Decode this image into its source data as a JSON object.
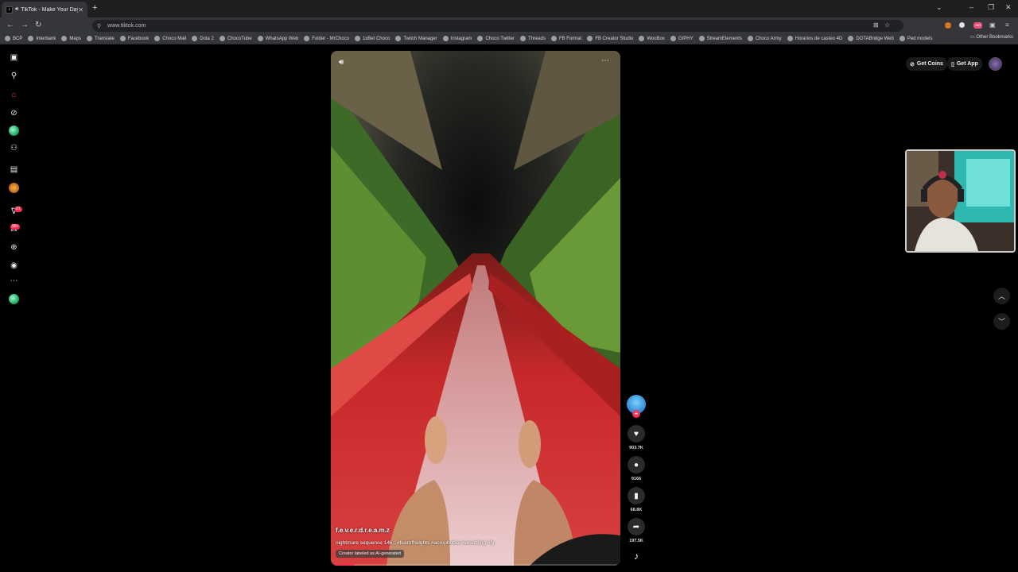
{
  "browser": {
    "tab_title": "TikTok - Make Your Day",
    "url": "www.tiktok.com",
    "bookmarks": [
      "BCP",
      "Interbank",
      "Maps",
      "Translate",
      "Facebook",
      "Choco Mail",
      "Dota 2",
      "ChocoTube",
      "WhatsApp Web",
      "Folder - MrChoco",
      "1xBet Choco",
      "Twitch Manager",
      "Instagram",
      "Choco Twitter",
      "Threads",
      "FB Format",
      "FB Creator Studio",
      "WooBox",
      "GIPHY",
      "StreamElements",
      "Choco Army",
      "Horarios de casteo 4D",
      "DOTABridge Web",
      "Ped models"
    ],
    "other_bookmarks": "Other Bookmarks",
    "ext_badge": "JAR"
  },
  "sidebar": {
    "badges": {
      "notifications": "21",
      "messages": "99+"
    }
  },
  "header": {
    "get_coins": "Get Coins",
    "get_app": "Get App"
  },
  "video": {
    "username": "f.e.v.e.r.d.r.e.a.m.z",
    "caption": "nightmare sequence 146...#fearofheights #acrophobia #unsettling #fy",
    "ai_label": "Creator labeled as AI-generated",
    "progress": 0.08
  },
  "actions": {
    "likes": "903.7K",
    "comments": "9166",
    "saves": "68.8K",
    "shares": "197.5K"
  },
  "colors": {
    "accent": "#fe2c55",
    "slide": "#c8292a",
    "background": "#000000"
  }
}
